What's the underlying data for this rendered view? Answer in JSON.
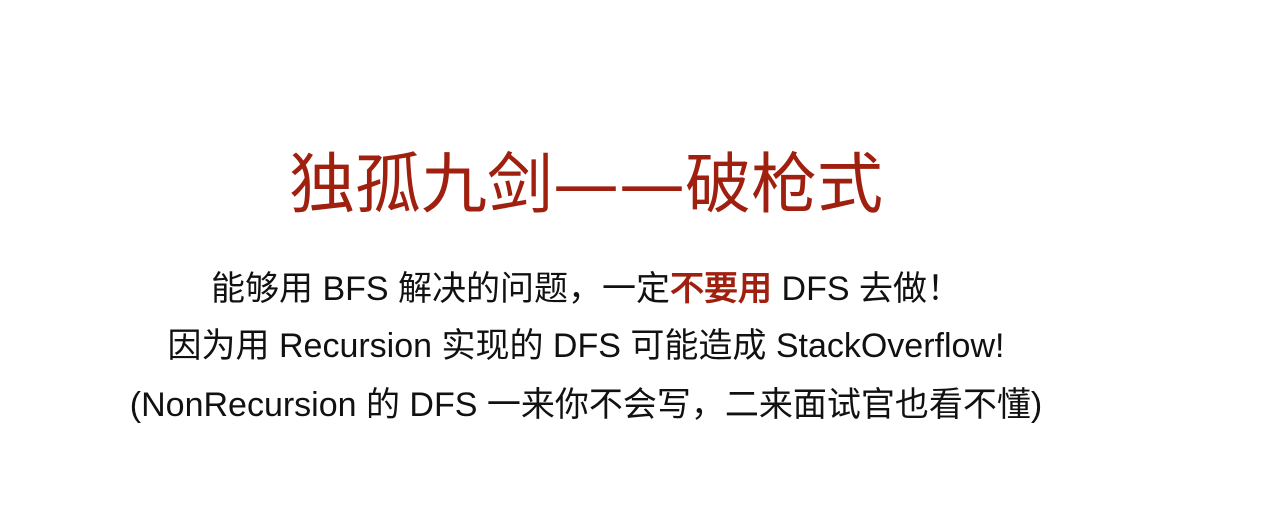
{
  "title": "独孤九剑——破枪式",
  "lines": [
    {
      "before": "能够用 BFS 解决的问题，一定",
      "emphasis": "不要用",
      "after": " DFS 去做！"
    },
    {
      "text": "因为用 Recursion 实现的 DFS 可能造成 StackOverflow!"
    },
    {
      "text": "(NonRecursion 的 DFS 一来你不会写，二来面试官也看不懂)"
    }
  ],
  "colors": {
    "accent": "#a0200f",
    "text": "#111111",
    "background": "#ffffff"
  }
}
